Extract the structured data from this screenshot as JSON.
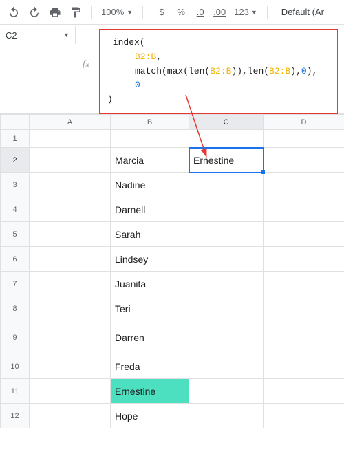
{
  "toolbar": {
    "zoom": "100%",
    "currency": "$",
    "percent": "%",
    "dec_dec": ".0",
    "inc_dec": ".00",
    "num_fmt": "123",
    "font": "Default (Ar"
  },
  "cell_ref": "C2",
  "fx_label": "fx",
  "formula": {
    "line1_a": "=index(",
    "line2_rng": "B2:B",
    "line2_post": ",",
    "line3_pre": "match(max(len(",
    "line3_rng1": "B2:B",
    "line3_mid": ")),len(",
    "line3_rng2": "B2:B",
    "line3_post": "),",
    "line3_zero": "0",
    "line3_end": "),",
    "line4_zero": "0",
    "line5": ")"
  },
  "columns": [
    "A",
    "B",
    "C",
    "D"
  ],
  "rows": [
    {
      "n": "1",
      "b": "",
      "c": "",
      "cls": "short"
    },
    {
      "n": "2",
      "b": "Marcia",
      "c": "Ernestine",
      "cls": ""
    },
    {
      "n": "3",
      "b": "Nadine",
      "c": "",
      "cls": ""
    },
    {
      "n": "4",
      "b": "Darnell",
      "c": "",
      "cls": ""
    },
    {
      "n": "5",
      "b": "Sarah",
      "c": "",
      "cls": ""
    },
    {
      "n": "6",
      "b": "Lindsey",
      "c": "",
      "cls": ""
    },
    {
      "n": "7",
      "b": "Juanita",
      "c": "",
      "cls": ""
    },
    {
      "n": "8",
      "b": "Teri",
      "c": "",
      "cls": ""
    },
    {
      "n": "9",
      "b": "Darren",
      "c": "",
      "cls": "tall"
    },
    {
      "n": "10",
      "b": "Freda",
      "c": "",
      "cls": ""
    },
    {
      "n": "11",
      "b": "Ernestine",
      "c": "",
      "cls": "",
      "hl": true
    },
    {
      "n": "12",
      "b": "Hope",
      "c": "",
      "cls": ""
    }
  ],
  "active": {
    "col": "C",
    "row": "2"
  }
}
